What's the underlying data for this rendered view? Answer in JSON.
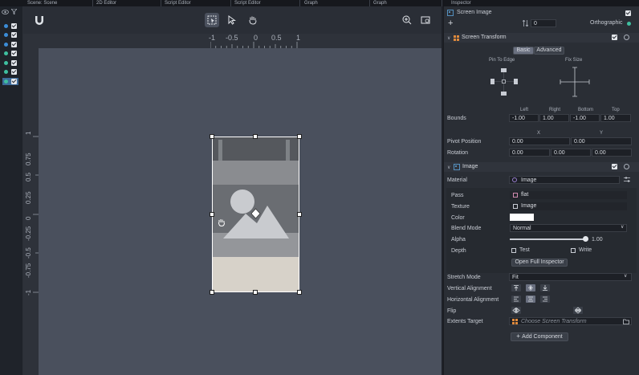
{
  "tabs": [
    "Scene: Scene",
    "2D Editor",
    "Script Editor",
    "Script Editor",
    "Graph",
    "Graph"
  ],
  "ruler": {
    "h_ticks": [
      "-1",
      "-0.5",
      "0",
      "0.5",
      "1"
    ],
    "v_ticks": [
      "1",
      "0.75",
      "0.5",
      "0.25",
      "0",
      "-0.25",
      "-0.5",
      "-0.75",
      "-1"
    ]
  },
  "inspector": {
    "title": "Inspector",
    "object_name": "Screen Image",
    "layer_value": "0",
    "ortho_label": "Orthographic",
    "screen_transform": {
      "title": "Screen Transform",
      "tab_basic": "Basic",
      "tab_advanced": "Advanced",
      "pin_label": "Pin To Edge",
      "fix_label": "Fix Size",
      "bounds_headers": [
        "Left",
        "Right",
        "Bottom",
        "Top"
      ],
      "bounds_label": "Bounds",
      "bounds_values": [
        "-1.00",
        "1.00",
        "-1.00",
        "1.00"
      ],
      "xy_headers": [
        "X",
        "Y"
      ],
      "pivot_label": "Pivot Position",
      "pivot_values": [
        "0.00",
        "0.00"
      ],
      "rotation_label": "Rotation",
      "rotation_values": [
        "0.00",
        "0.00",
        "0.00"
      ]
    },
    "image": {
      "title": "Image",
      "material_label": "Material",
      "material_value": "Image",
      "pass_label": "Pass",
      "pass_value": "flat",
      "texture_label": "Texture",
      "texture_value": "Image",
      "color_label": "Color",
      "color_value": "#ffffff",
      "blend_label": "Blend Mode",
      "blend_value": "Normal",
      "alpha_label": "Alpha",
      "alpha_value": "1.00",
      "alpha_fraction": 1.0,
      "depth_label": "Depth",
      "depth_test": "Test",
      "depth_write": "Write",
      "full_inspector_button": "Open Full Inspector",
      "stretch_label": "Stretch Mode",
      "stretch_value": "Fit",
      "valign_label": "Vertical Alignment",
      "halign_label": "Horizontal Alignment",
      "flip_label": "Flip",
      "extents_label": "Extents Target",
      "extents_placeholder": "Choose Screen Transform"
    },
    "add_component_button": "Add Component"
  },
  "colors": {
    "accent": "#3fbfa0",
    "viewport_bg": "#4a505d",
    "panel_bg": "#2a2e35"
  },
  "icons": [
    "eye-icon",
    "filter-icon",
    "logo-icon",
    "frame-select-icon",
    "pointer-icon",
    "hand-icon",
    "zoom-icon",
    "fit-icon",
    "gear-icon",
    "folder-icon"
  ]
}
